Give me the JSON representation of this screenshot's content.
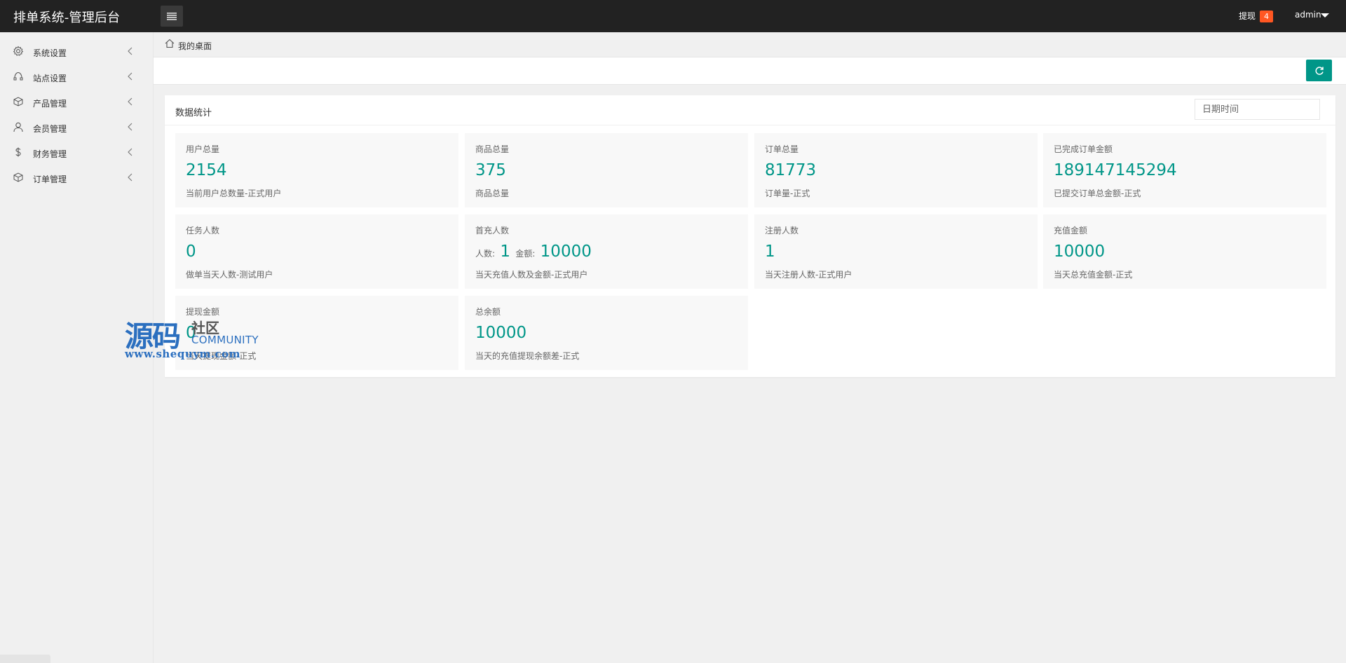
{
  "header": {
    "title": "排单系统-管理后台",
    "withdraw_label": "提现",
    "withdraw_count": "4",
    "user": "admin"
  },
  "sidebar": {
    "items": [
      {
        "label": "系统设置",
        "icon": "gear-icon"
      },
      {
        "label": "站点设置",
        "icon": "site-icon"
      },
      {
        "label": "产品管理",
        "icon": "box-icon"
      },
      {
        "label": "会员管理",
        "icon": "user-icon"
      },
      {
        "label": "财务管理",
        "icon": "dollar-icon"
      },
      {
        "label": "订单管理",
        "icon": "box-icon"
      }
    ]
  },
  "breadcrumb": {
    "text": "我的桌面"
  },
  "panel": {
    "title": "数据统计",
    "date_placeholder": "日期时间"
  },
  "cards": [
    {
      "title": "用户总量",
      "value": "2154",
      "desc": "当前用户总数量-正式用户"
    },
    {
      "title": "商品总量",
      "value": "375",
      "desc": "商品总量"
    },
    {
      "title": "订单总量",
      "value": "81773",
      "desc": "订单量-正式"
    },
    {
      "title": "已完成订单金额",
      "value": "189147145294",
      "desc": "已提交订单总金额-正式"
    },
    {
      "title": "任务人数",
      "value": "0",
      "desc": "做单当天人数-测试用户"
    },
    {
      "title": "首充人数",
      "people_label": "人数:",
      "people_value": "1",
      "amount_label": "金额:",
      "amount_value": "10000",
      "desc": "当天充值人数及金额-正式用户"
    },
    {
      "title": "注册人数",
      "value": "1",
      "desc": "当天注册人数-正式用户"
    },
    {
      "title": "充值金额",
      "value": "10000",
      "desc": "当天总充值金额-正式"
    },
    {
      "title": "提现金额",
      "value": "0",
      "desc": "当天提现金额-正式"
    },
    {
      "title": "总余额",
      "value": "10000",
      "desc": "当天的充值提现余额差-正式"
    }
  ],
  "watermark": {
    "big": "源码",
    "small": "社区",
    "community": "COMMUNITY",
    "url": "www.shequym.com"
  },
  "colors": {
    "accent": "#009688",
    "badge": "#ff5722",
    "header": "#222222"
  }
}
